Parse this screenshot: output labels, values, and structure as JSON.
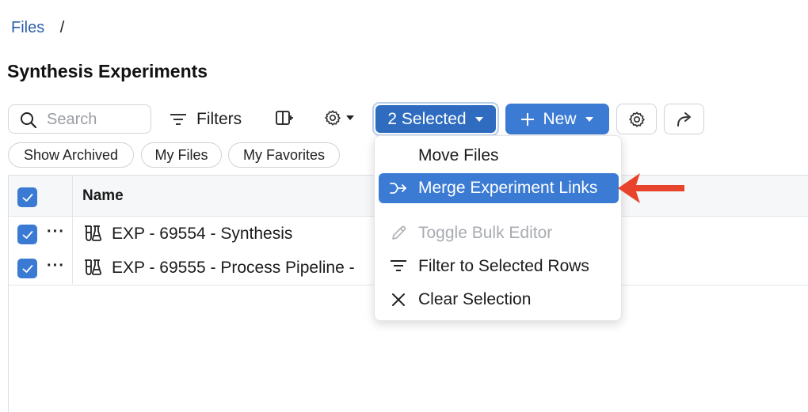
{
  "breadcrumb": {
    "root": "Files",
    "separator": "/"
  },
  "page": {
    "title": "Synthesis Experiments"
  },
  "toolbar": {
    "search_placeholder": "Search",
    "filters_label": "Filters",
    "selected_label": "2 Selected",
    "new_label": "New"
  },
  "chips": [
    "Show Archived",
    "My Files",
    "My Favorites"
  ],
  "grid": {
    "header": {
      "name": "Name",
      "all_selected": true
    },
    "rows": [
      {
        "name": "EXP - 69554 - Synthesis",
        "selected": true
      },
      {
        "name": "EXP - 69555 - Process Pipeline -",
        "selected": true
      }
    ]
  },
  "selection_menu": {
    "items": [
      {
        "label": "Move Files",
        "icon": "none",
        "state": "normal"
      },
      {
        "label": "Merge Experiment Links",
        "icon": "merge-icon",
        "state": "highlighted"
      },
      {
        "label": "Toggle Bulk Editor",
        "icon": "pencil-icon",
        "state": "disabled"
      },
      {
        "label": "Filter to Selected Rows",
        "icon": "filter-icon",
        "state": "normal"
      },
      {
        "label": "Clear Selection",
        "icon": "close-icon",
        "state": "normal"
      }
    ]
  },
  "colors": {
    "primary": "#3b7bd4",
    "selected_button": "#2f6cc0",
    "link": "#2e5fa7",
    "annotation_arrow": "#e8442d",
    "disabled_text": "#a8abb0"
  }
}
